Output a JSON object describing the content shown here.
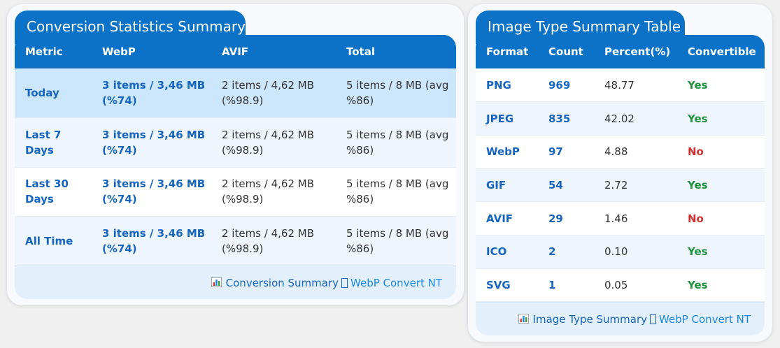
{
  "conversion_panel": {
    "title": "Conversion Statistics Summary",
    "columns": [
      "Metric",
      "WebP",
      "AVIF",
      "Total"
    ],
    "rows": [
      {
        "metric": "Today",
        "webp": "3 items / 3,46 MB (%74)",
        "avif": "2 items / 4,62 MB (%98.9)",
        "total": "5 items / 8 MB (avg %86)"
      },
      {
        "metric": "Last 7 Days",
        "webp": "3 items / 3,46 MB (%74)",
        "avif": "2 items / 4,62 MB (%98.9)",
        "total": "5 items / 8 MB (avg %86)"
      },
      {
        "metric": "Last 30 Days",
        "webp": "3 items / 3,46 MB (%74)",
        "avif": "2 items / 4,62 MB (%98.9)",
        "total": "5 items / 8 MB (avg %86)"
      },
      {
        "metric": "All Time",
        "webp": "3 items / 3,46 MB (%74)",
        "avif": "2 items / 4,62 MB (%98.9)",
        "total": "5 items / 8 MB (avg %86)"
      }
    ],
    "highlighted_row": 0,
    "footer": {
      "label": "Conversion Summary",
      "brand": "WebP Convert NT",
      "icon": "bar-chart-icon"
    }
  },
  "image_type_panel": {
    "title": "Image Type Summary Table",
    "columns": [
      "Format",
      "Count",
      "Percent(%)",
      "Convertible"
    ],
    "rows": [
      {
        "format": "PNG",
        "count": "969",
        "percent": "48.77",
        "convertible": "Yes"
      },
      {
        "format": "JPEG",
        "count": "835",
        "percent": "42.02",
        "convertible": "Yes"
      },
      {
        "format": "WebP",
        "count": "97",
        "percent": "4.88",
        "convertible": "No"
      },
      {
        "format": "GIF",
        "count": "54",
        "percent": "2.72",
        "convertible": "Yes"
      },
      {
        "format": "AVIF",
        "count": "29",
        "percent": "1.46",
        "convertible": "No"
      },
      {
        "format": "ICO",
        "count": "2",
        "percent": "0.10",
        "convertible": "Yes"
      },
      {
        "format": "SVG",
        "count": "1",
        "percent": "0.05",
        "convertible": "Yes"
      }
    ],
    "footer": {
      "label": "Image Type Summary",
      "brand": "WebP Convert NT",
      "icon": "bar-chart-icon"
    }
  },
  "colors": {
    "header_blue": "#0b72c7",
    "highlight_row": "#cce6fb",
    "alt_row": "#eef5fc",
    "yes_green": "#21913f",
    "no_red": "#d32f2f"
  }
}
